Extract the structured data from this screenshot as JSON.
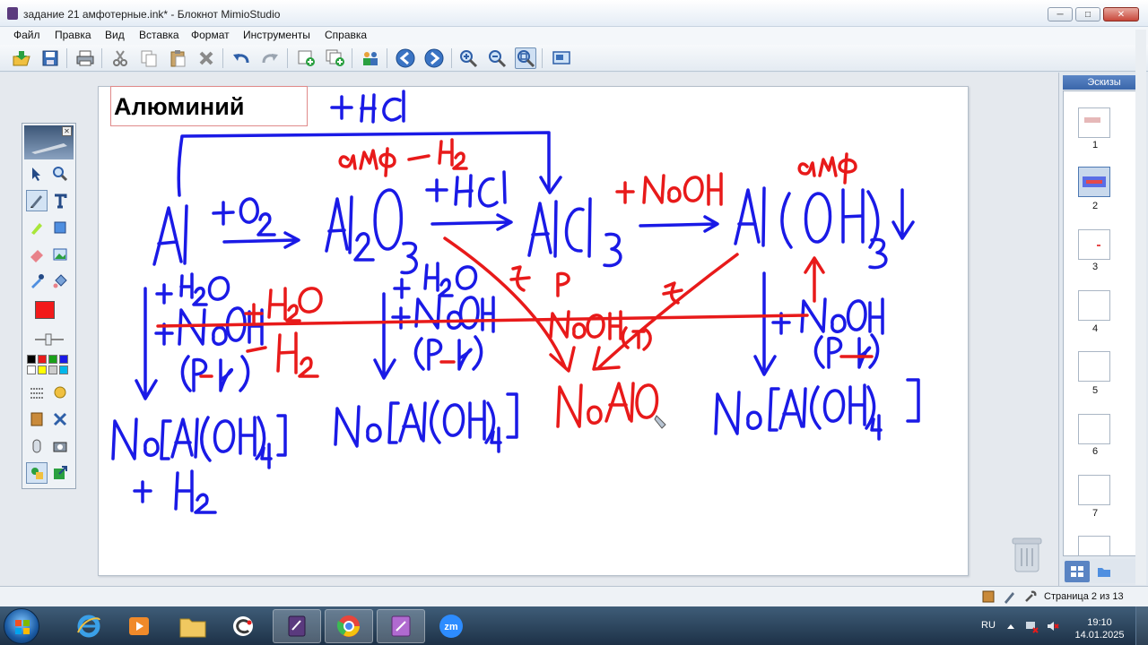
{
  "window": {
    "title": "задание 21 амфотерные.ink* - Блокнот MimioStudio",
    "buttons": [
      "minimize",
      "maximize",
      "close"
    ]
  },
  "menu": [
    "Файл",
    "Правка",
    "Вид",
    "Вставка",
    "Формат",
    "Инструменты",
    "Справка"
  ],
  "toolbar_icons": [
    "open-icon",
    "save-icon",
    "print-icon",
    "cut-icon",
    "copy-icon",
    "paste-icon",
    "delete-icon",
    "undo-icon",
    "redo-icon",
    "new-page-icon",
    "duplicate-page-icon",
    "users-icon",
    "back-icon",
    "forward-icon",
    "zoom-in-icon",
    "zoom-out-icon",
    "zoom-fit-icon",
    "screen-icon"
  ],
  "page": {
    "heading": "Алюминий",
    "ink_colors": {
      "blue": "#1a1ae6",
      "red": "#e81a1a"
    }
  },
  "sidebar": {
    "title": "Эскизы",
    "thumbnails": [
      "1",
      "2",
      "3",
      "4",
      "5",
      "6",
      "7"
    ],
    "selected": "2"
  },
  "palette": {
    "current_color": "#f21a1a",
    "swatches": [
      "#000000",
      "#e81a1a",
      "#1aa01a",
      "#1a1ae6",
      "#ffffff",
      "#ffff00",
      "#cccccc",
      "#00b7eb"
    ]
  },
  "status": {
    "page_info": "Страница 2 из 13"
  },
  "taskbar": {
    "language": "RU",
    "time": "19:10",
    "date": "14.01.2025"
  }
}
